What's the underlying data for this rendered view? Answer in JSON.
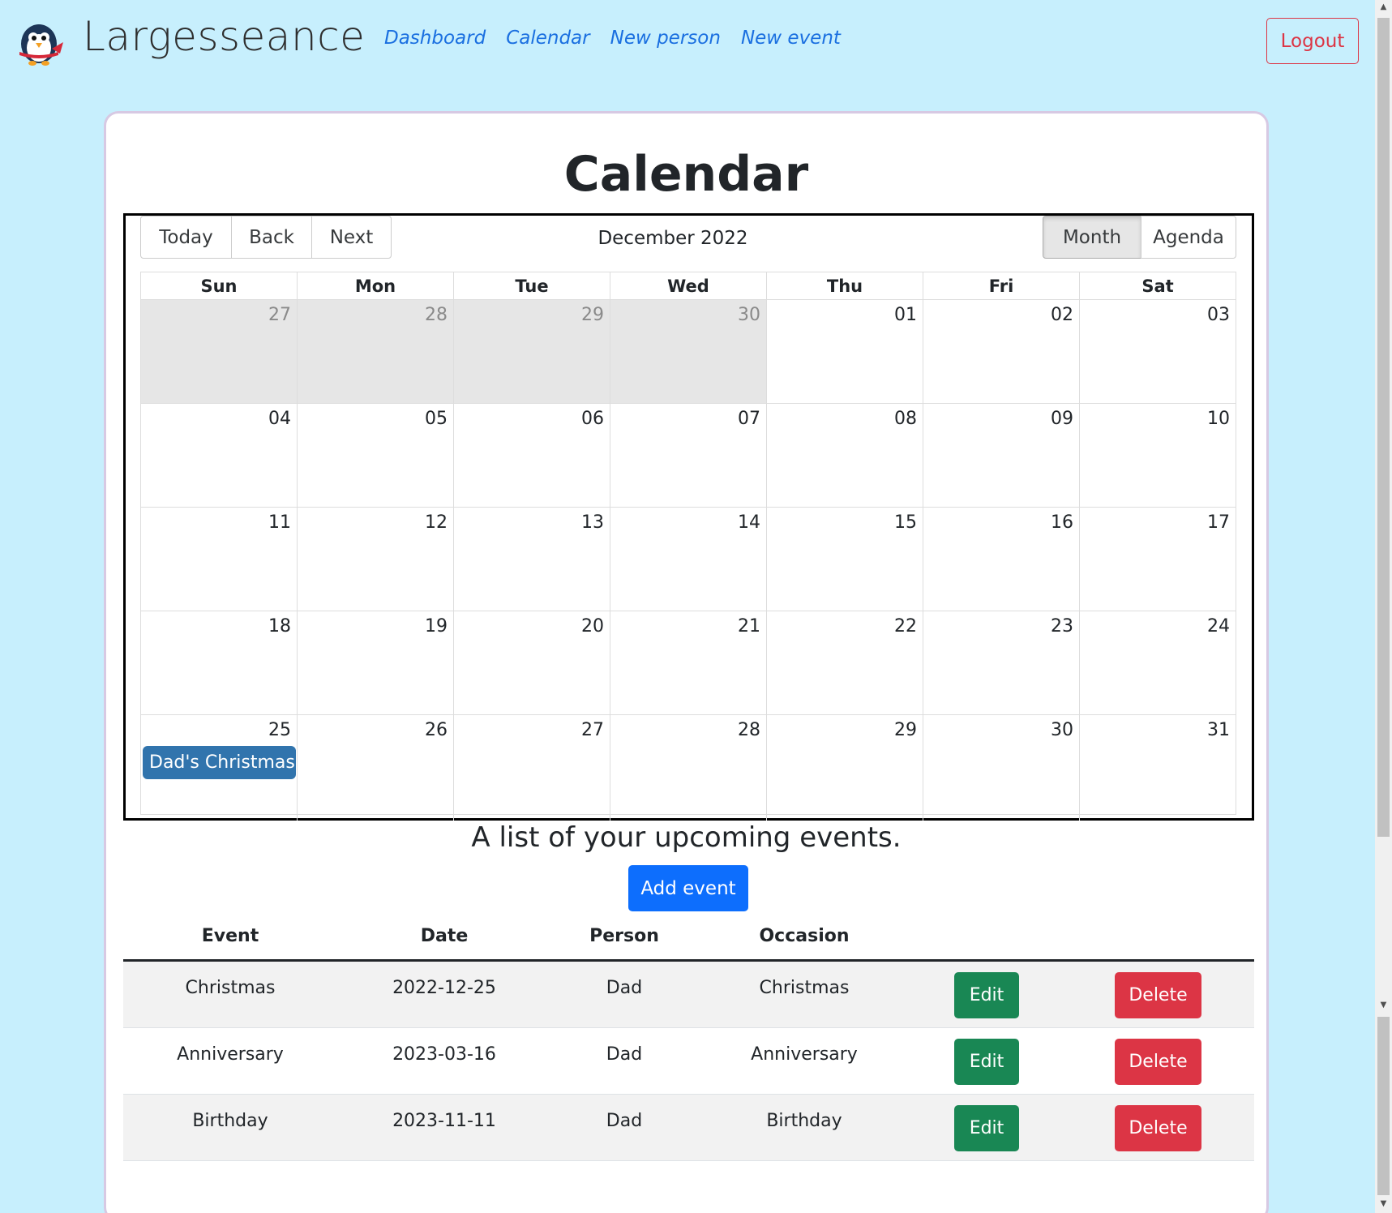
{
  "brand": {
    "name": "Largesseance"
  },
  "nav": {
    "links": [
      "Dashboard",
      "Calendar",
      "New person",
      "New event"
    ],
    "logout_label": "Logout"
  },
  "page": {
    "title": "Calendar"
  },
  "calendar": {
    "toolbar": {
      "today": "Today",
      "back": "Back",
      "next": "Next",
      "label": "December 2022",
      "views": {
        "month": "Month",
        "agenda": "Agenda",
        "active": "Month"
      }
    },
    "weekdays": [
      "Sun",
      "Mon",
      "Tue",
      "Wed",
      "Thu",
      "Fri",
      "Sat"
    ],
    "weeks": [
      [
        "27",
        "28",
        "29",
        "30",
        "01",
        "02",
        "03"
      ],
      [
        "04",
        "05",
        "06",
        "07",
        "08",
        "09",
        "10"
      ],
      [
        "11",
        "12",
        "13",
        "14",
        "15",
        "16",
        "17"
      ],
      [
        "18",
        "19",
        "20",
        "21",
        "22",
        "23",
        "24"
      ],
      [
        "25",
        "26",
        "27",
        "28",
        "29",
        "30",
        "31"
      ]
    ],
    "events": [
      {
        "title": "Dad's Christmas",
        "date": "25",
        "color": "#3174ad"
      }
    ]
  },
  "upcoming": {
    "title": "A list of your upcoming events.",
    "add_label": "Add event",
    "columns": [
      "Event",
      "Date",
      "Person",
      "Occasion"
    ],
    "rows": [
      {
        "event": "Christmas",
        "date": "2022-12-25",
        "person": "Dad",
        "occasion": "Christmas"
      },
      {
        "event": "Anniversary",
        "date": "2023-03-16",
        "person": "Dad",
        "occasion": "Anniversary"
      },
      {
        "event": "Birthday",
        "date": "2023-11-11",
        "person": "Dad",
        "occasion": "Birthday"
      }
    ],
    "edit_label": "Edit",
    "delete_label": "Delete"
  },
  "colors": {
    "background": "#c7effd",
    "link": "#1a6fe0",
    "danger": "#dc3545",
    "primary": "#0d6efd",
    "success": "#198754",
    "event": "#3174ad"
  }
}
